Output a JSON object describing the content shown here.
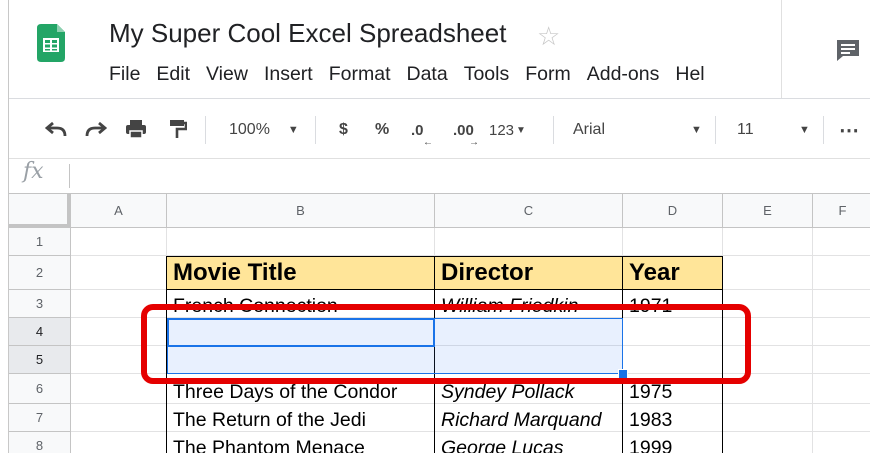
{
  "app": {
    "title": "My Super Cool Excel Spreadsheet",
    "star_glyph": "☆"
  },
  "menu": [
    "File",
    "Edit",
    "View",
    "Insert",
    "Format",
    "Data",
    "Tools",
    "Form",
    "Add-ons",
    "Hel"
  ],
  "toolbar": {
    "zoom": "100%",
    "currency": "$",
    "percent": "%",
    "dec_decrease": ".0",
    "dec_increase": ".00",
    "number_format": "123",
    "font": "Arial",
    "font_size": "11",
    "more": "⋯"
  },
  "formula_bar": {
    "fx_label": "fx",
    "value": ""
  },
  "columns": [
    "A",
    "B",
    "C",
    "D",
    "E",
    "F"
  ],
  "rows": [
    "1",
    "2",
    "3",
    "4",
    "5",
    "6",
    "7",
    "8"
  ],
  "table": {
    "headers": [
      "Movie Title",
      "Director",
      "Year"
    ],
    "rows": [
      [
        "French Connection",
        "William Friedkin",
        "1971"
      ],
      [
        "",
        "",
        ""
      ],
      [
        "",
        "",
        ""
      ],
      [
        "Three Days of the Condor",
        "Syndey Pollack",
        "1975"
      ],
      [
        "The Return of the Jedi",
        "Richard Marquand",
        "1983"
      ],
      [
        "The Phantom Menace",
        "George Lucas",
        "1999"
      ]
    ]
  },
  "colors": {
    "header_fill": "#ffe599",
    "selection": "#1a73e8",
    "highlight_box": "#e50000"
  }
}
